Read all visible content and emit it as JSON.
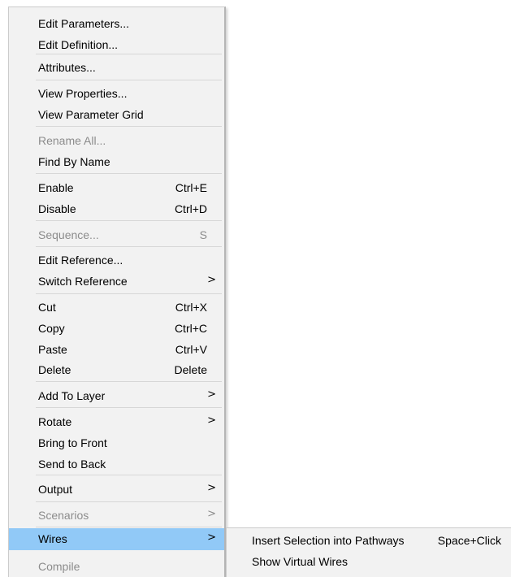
{
  "context_menu": {
    "items": [
      {
        "label": "Edit Parameters...",
        "shortcut": ""
      },
      {
        "label": "Edit Definition...",
        "shortcut": ""
      },
      {
        "label": "Attributes...",
        "shortcut": ""
      },
      {
        "label": "View Properties...",
        "shortcut": ""
      },
      {
        "label": "View Parameter Grid",
        "shortcut": ""
      },
      {
        "label": "Rename All...",
        "shortcut": "",
        "disabled": true
      },
      {
        "label": "Find By Name",
        "shortcut": ""
      },
      {
        "label": "Enable",
        "shortcut": "Ctrl+E"
      },
      {
        "label": "Disable",
        "shortcut": "Ctrl+D"
      },
      {
        "label": "Sequence...",
        "shortcut": "S",
        "disabled": true
      },
      {
        "label": "Edit Reference...",
        "shortcut": ""
      },
      {
        "label": "Switch Reference",
        "shortcut": "",
        "submenu": true
      },
      {
        "label": "Cut",
        "shortcut": "Ctrl+X"
      },
      {
        "label": "Copy",
        "shortcut": "Ctrl+C"
      },
      {
        "label": "Paste",
        "shortcut": "Ctrl+V"
      },
      {
        "label": "Delete",
        "shortcut": "Delete"
      },
      {
        "label": "Add To Layer",
        "shortcut": "",
        "submenu": true
      },
      {
        "label": "Rotate",
        "shortcut": "",
        "submenu": true
      },
      {
        "label": "Bring to Front",
        "shortcut": ""
      },
      {
        "label": "Send to Back",
        "shortcut": ""
      },
      {
        "label": "Output",
        "shortcut": "",
        "submenu": true
      },
      {
        "label": "Scenarios",
        "shortcut": "",
        "submenu": true,
        "disabled": true
      },
      {
        "label": "Wires",
        "shortcut": "",
        "submenu": true,
        "highlighted": true
      },
      {
        "label": "Compile",
        "shortcut": "",
        "disabled": true
      }
    ],
    "submenu_arrow": ">"
  },
  "wires_submenu": {
    "items": [
      {
        "label": "Insert Selection into Pathways",
        "shortcut": "Space+Click"
      },
      {
        "label": "Show Virtual Wires",
        "shortcut": ""
      }
    ]
  },
  "colors": {
    "menu_background": "#f2f2f2",
    "highlight": "#91c9f7",
    "disabled_text": "#8c8c8c",
    "separator": "#d7d7d7"
  }
}
